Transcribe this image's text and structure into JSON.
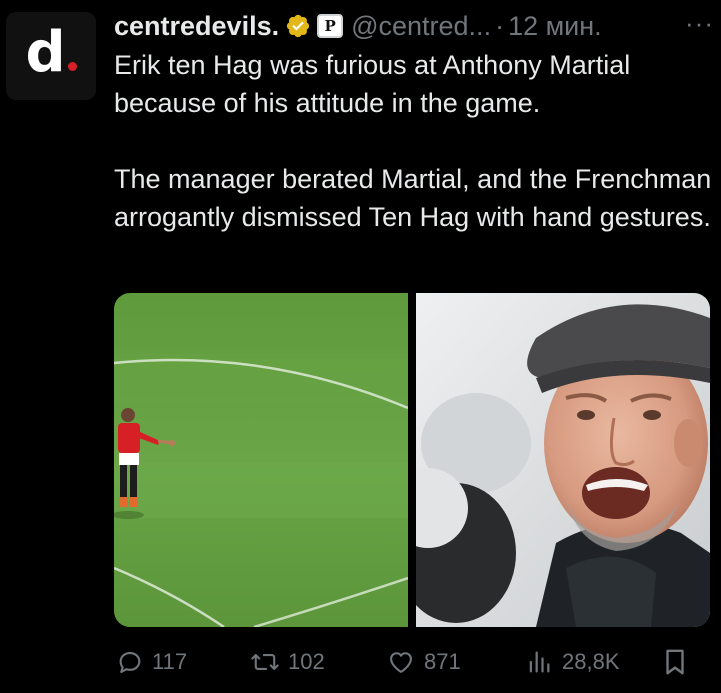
{
  "author": {
    "display_name": "centredevils.",
    "handle": "@centred...",
    "separator": "·",
    "time": "12 мин.",
    "avatar_letter": "d",
    "affiliate_badge": "P"
  },
  "menu": {
    "more_label": "···"
  },
  "tweet": {
    "paragraphs": [
      "Erik ten Hag was furious at Anthony Martial because of his attitude in the game.",
      "The manager berated Martial, and the Frenchman arrogantly dismissed Ten Hag with hand gestures."
    ]
  },
  "media": {
    "images": [
      "player-on-pitch-photo",
      "manager-shouting-photo"
    ]
  },
  "actions": {
    "replies": "117",
    "retweets": "102",
    "likes": "871",
    "views": "28,8K"
  },
  "colors": {
    "background": "#000000",
    "text_primary": "#e7e9ea",
    "text_secondary": "#71767b",
    "verified_gold": "#e2b719",
    "brand_red": "#d61f26"
  },
  "icons": {
    "verified": "verified-badge-icon",
    "reply": "reply-icon",
    "retweet": "retweet-icon",
    "like": "heart-icon",
    "views": "views-icon",
    "bookmark": "bookmark-icon",
    "more": "more-options-icon"
  }
}
